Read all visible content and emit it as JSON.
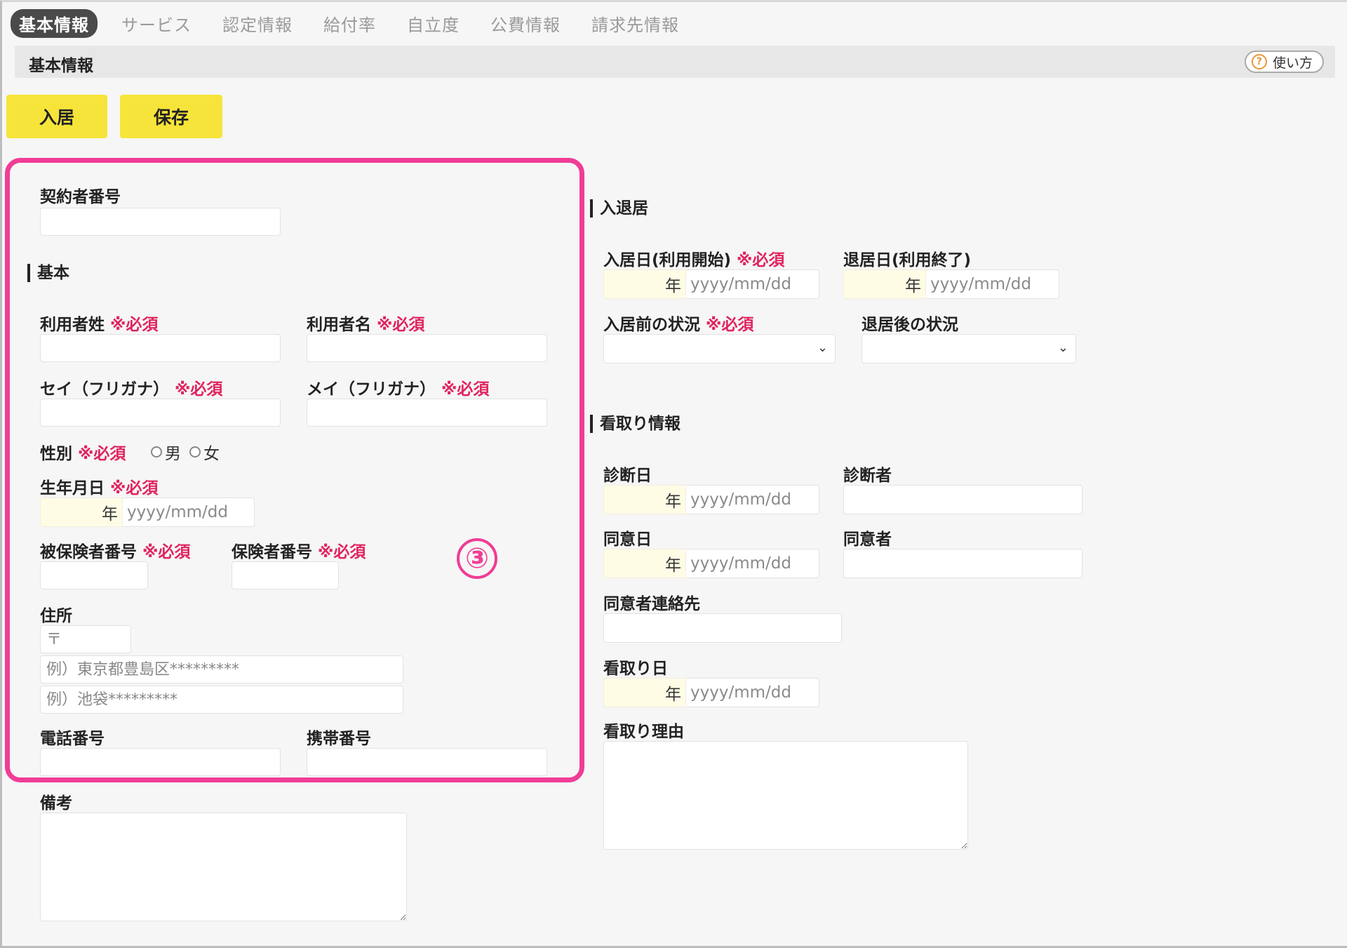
{
  "tabs": [
    {
      "label": "基本情報",
      "active": true
    },
    {
      "label": "サービス"
    },
    {
      "label": "認定情報"
    },
    {
      "label": "給付率"
    },
    {
      "label": "自立度"
    },
    {
      "label": "公費情報"
    },
    {
      "label": "請求先情報"
    }
  ],
  "header": {
    "title": "基本情報",
    "help_label": "使い方"
  },
  "buttons": {
    "move_in": "入居",
    "save": "保存"
  },
  "required_mark": "※必須",
  "left": {
    "contract_no_label": "契約者番号",
    "basic_section": "基本",
    "last_name_label": "利用者姓",
    "first_name_label": "利用者名",
    "last_kana_label": "セイ（フリガナ）",
    "first_kana_label": "メイ（フリガナ）",
    "gender_label": "性別",
    "gender_male": "男",
    "gender_female": "女",
    "birth_label": "生年月日",
    "insured_no_label": "被保険者番号",
    "insurer_no_label": "保険者番号",
    "address_label": "住所",
    "postal_placeholder": "〒",
    "address1_placeholder": "例）東京都豊島区*********",
    "address2_placeholder": "例）池袋*********",
    "phone_label": "電話番号",
    "mobile_label": "携帯番号",
    "notes_label": "備考"
  },
  "date": {
    "year_suffix": "年",
    "placeholder": "yyyy/mm/dd"
  },
  "right": {
    "move_section": "入退居",
    "move_in_date_label": "入居日(利用開始)",
    "move_out_date_label": "退居日(利用終了)",
    "before_status_label": "入居前の状況",
    "after_status_label": "退居後の状況",
    "terminal_section": "看取り情報",
    "diagnosis_date_label": "診断日",
    "diagnoser_label": "診断者",
    "consent_date_label": "同意日",
    "consenter_label": "同意者",
    "consenter_contact_label": "同意者連絡先",
    "terminal_date_label": "看取り日",
    "terminal_reason_label": "看取り理由"
  },
  "annotation": {
    "number": "③",
    "color": "#f03c96"
  },
  "colors": {
    "accent_yellow": "#f7e43a",
    "required_red": "#e0245e",
    "tab_active_bg": "#4a4a4a"
  }
}
